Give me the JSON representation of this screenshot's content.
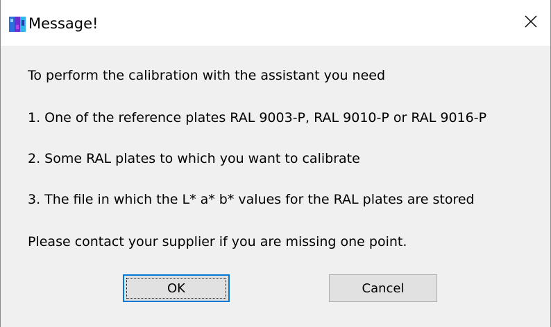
{
  "window": {
    "title": "Message!",
    "app_icon": "app-icon",
    "close_icon": "close-icon"
  },
  "message": {
    "intro": "To perform the calibration with the assistant you need",
    "item1": "1. One of the reference plates RAL 9003-P, RAL 9010-P or RAL 9016-P",
    "item2": "2. Some RAL plates to which you want to calibrate",
    "item3": "3. The file in which the L* a* b* values for the RAL plates are stored",
    "contact": "Please contact your supplier if you are missing one point."
  },
  "buttons": {
    "ok_label": "OK",
    "cancel_label": "Cancel"
  },
  "colors": {
    "focus_border": "#0078d7",
    "dialog_background": "#f0f0f0",
    "title_background": "#ffffff"
  }
}
